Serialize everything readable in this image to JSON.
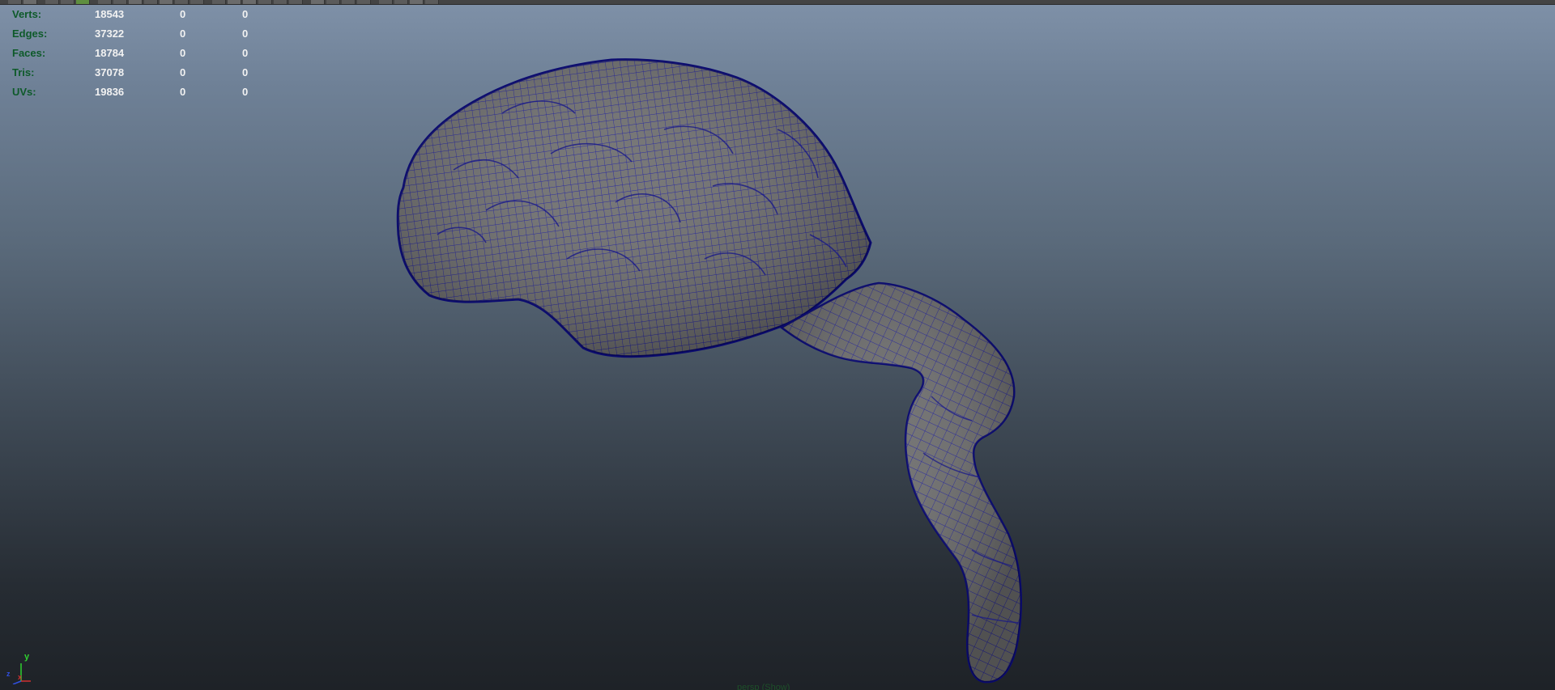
{
  "hud": {
    "rows": [
      {
        "label": "Verts:",
        "v1": "18543",
        "v2": "0",
        "v3": "0"
      },
      {
        "label": "Edges:",
        "v1": "37322",
        "v2": "0",
        "v3": "0"
      },
      {
        "label": "Faces:",
        "v1": "18784",
        "v2": "0",
        "v3": "0"
      },
      {
        "label": "Tris:",
        "v1": "37078",
        "v2": "0",
        "v3": "0"
      },
      {
        "label": "UVs:",
        "v1": "19836",
        "v2": "0",
        "v3": "0"
      }
    ]
  },
  "gizmo": {
    "y": "y",
    "x": "x",
    "z": "z"
  },
  "camera_label": "persp (Show)",
  "colors": {
    "hud_label": "#0e5a2a",
    "hud_value": "#f2f2f2",
    "mesh_fill": "#6e6e6e",
    "wire": "#1a1a9a",
    "wire_edge": "#0a0a70"
  },
  "icons": [
    "axis-gizmo-icon"
  ]
}
